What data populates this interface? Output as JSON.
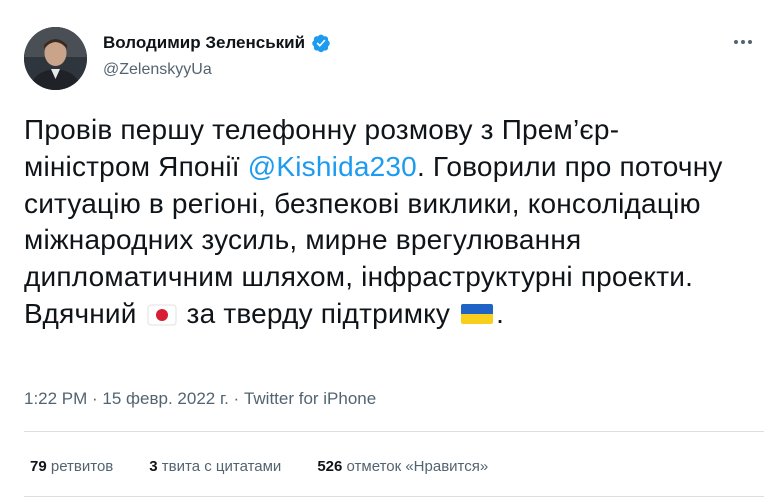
{
  "author": {
    "name": "Володимир Зеленський",
    "handle": "@ZelenskyyUa",
    "verified": true
  },
  "tweet": {
    "text_parts": {
      "p1": "Провів першу телефонну розмову з Прем’єр-міністром Японії ",
      "mention": "@Kishida230",
      "p2": ". Говорили про поточну ситуацію в регіоні, безпекові виклики, консолідацію міжнародних зусиль, мирне врегулювання дипломатичним шляхом, інфраструктурні проекти. Вдячний ",
      "p3": " за тверду підтримку ",
      "p4": "."
    },
    "emoji": [
      "japan-flag-icon",
      "ukraine-flag-icon"
    ]
  },
  "meta": {
    "time": "1:22 PM",
    "sep1": " · ",
    "date": "15 февр. 2022 г.",
    "sep2": " · ",
    "source": "Twitter for iPhone"
  },
  "stats": {
    "retweets_count": "79",
    "retweets_label": "ретвитов",
    "quotes_count": "3",
    "quotes_label": "твита с цитатами",
    "likes_count": "526",
    "likes_label": "отметок «Нравится»"
  },
  "colors": {
    "accent": "#1d9bf0",
    "secondary_text": "#536471",
    "divider": "#dadfe3",
    "japan_red": "#d81e34",
    "ukraine_blue": "#1f63c7",
    "ukraine_yellow": "#f7cf1c"
  }
}
